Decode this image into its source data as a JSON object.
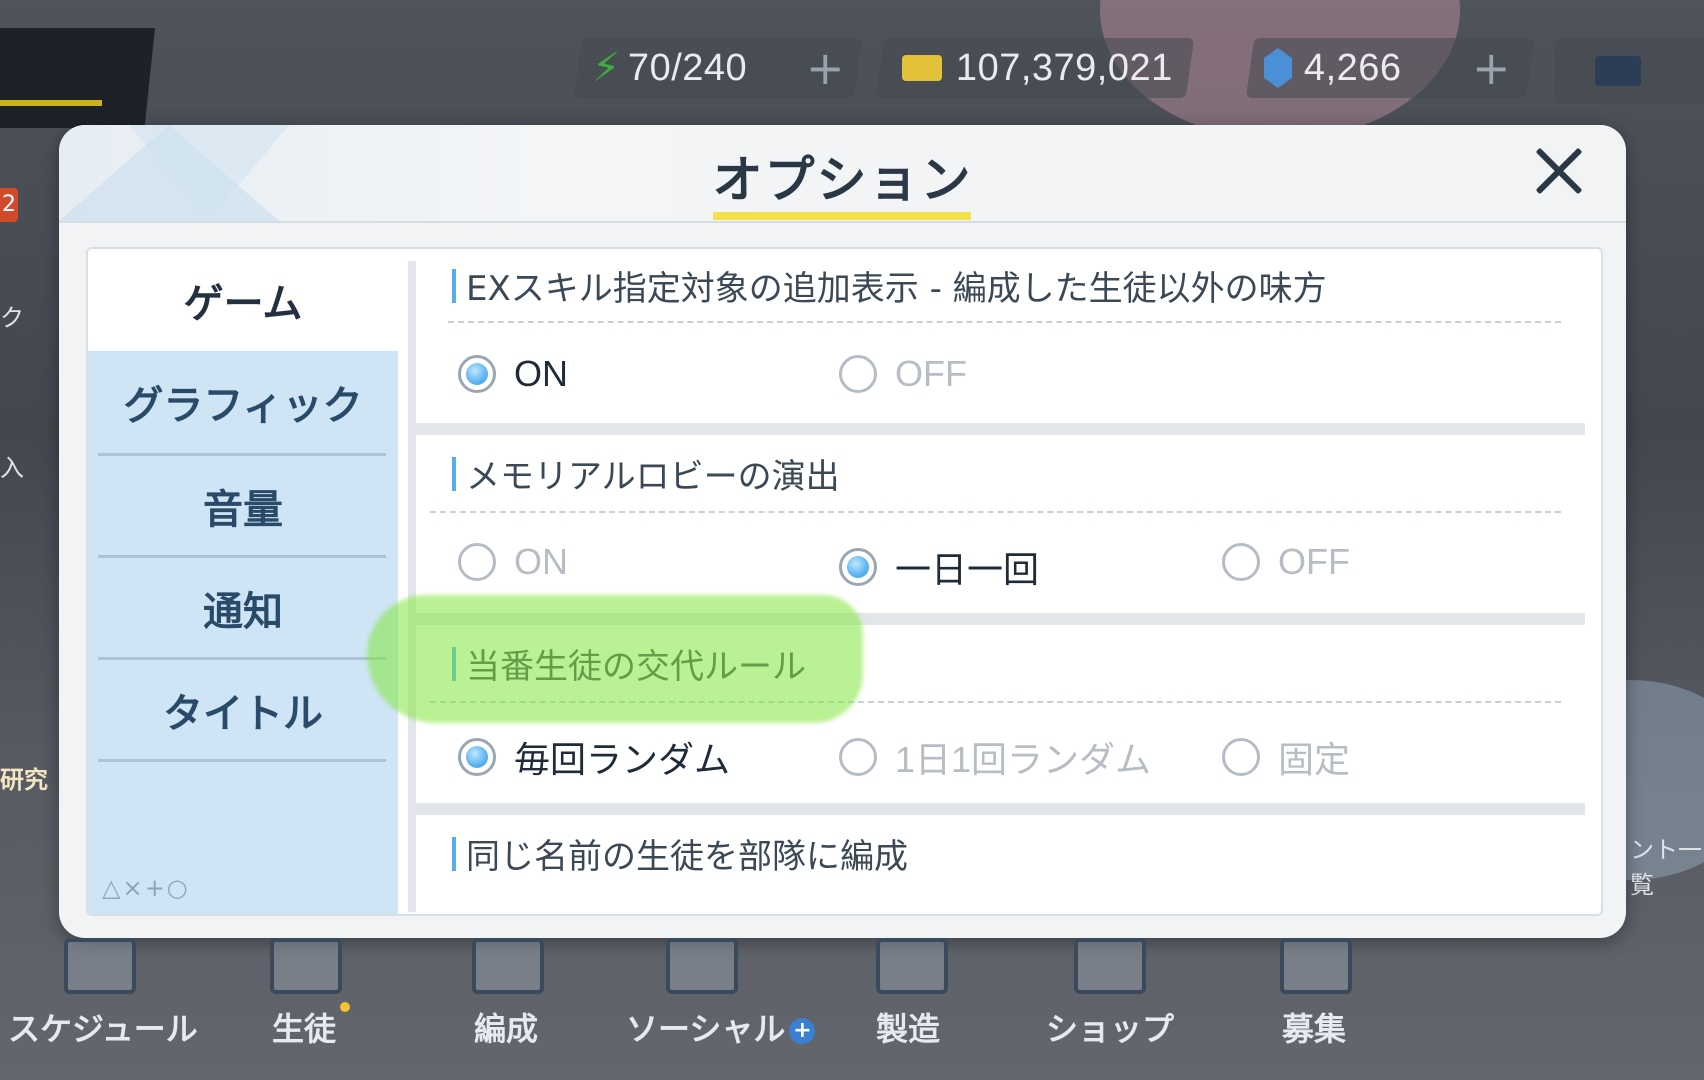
{
  "hud": {
    "stamina": "70/240",
    "credits": "107,379,021",
    "pyroxene": "4,266",
    "plus": "+"
  },
  "side": {
    "badge": "2",
    "text1": "ク",
    "text2": "入",
    "text3": "研究",
    "text4": "ント一覧"
  },
  "dialog": {
    "title": "オプション",
    "tabs": [
      {
        "label": "ゲーム"
      },
      {
        "label": "グラフィック"
      },
      {
        "label": "音量"
      },
      {
        "label": "通知"
      },
      {
        "label": "タイトル"
      }
    ],
    "marks": "△×+○",
    "settings": [
      {
        "title": "EXスキル指定対象の追加表示 - 編成した生徒以外の味方",
        "options": [
          "ON",
          "OFF"
        ],
        "selected": 0
      },
      {
        "title": "メモリアルロビーの演出",
        "options": [
          "ON",
          "一日一回",
          "OFF"
        ],
        "selected": 1
      },
      {
        "title": "当番生徒の交代ルール",
        "options": [
          "毎回ランダム",
          "1日1回ランダム",
          "固定"
        ],
        "selected": 0
      },
      {
        "title": "同じ名前の生徒を部隊に編成",
        "options": [],
        "selected": null
      }
    ]
  },
  "nav": {
    "items": [
      {
        "label": "スケジュール"
      },
      {
        "label": "生徒"
      },
      {
        "label": "編成"
      },
      {
        "label": "ソーシャル"
      },
      {
        "label": "製造"
      },
      {
        "label": "ショップ"
      },
      {
        "label": "募集"
      }
    ],
    "social_badge": "+"
  },
  "colors": {
    "accent": "#5cb3f0",
    "title_underline": "#f3e04a",
    "highlight": "#82e63c"
  }
}
